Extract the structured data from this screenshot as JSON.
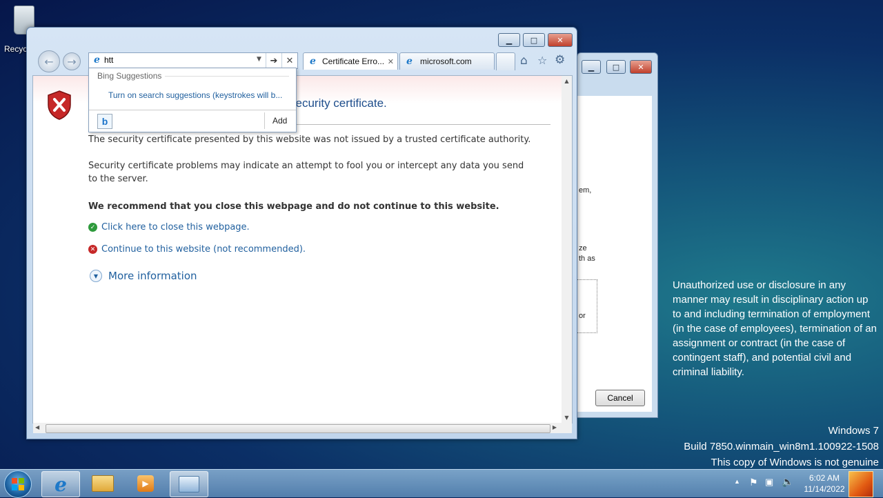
{
  "desktop": {
    "recycle_label": "Recyc",
    "notice": "Unauthorized use or disclosure in any manner may result in disciplinary action up to and including termination of employment (in the case of employees), termination of an assignment or contract (in the case of contingent staff), and potential civil and criminal liability.",
    "windows_info": {
      "line1": "Windows 7",
      "line2": "Build 7850.winmain_win8m1.100922-1508",
      "line3": "This copy of Windows is not genuine"
    }
  },
  "background_dialog": {
    "text_fragments": [
      "em,",
      "ze",
      "th as",
      "or"
    ],
    "cancel_label": "Cancel"
  },
  "browser": {
    "address_value": "htt",
    "suggestions": {
      "header": "Bing Suggestions",
      "item": "Turn on search suggestions (keystrokes will b...",
      "add_label": "Add"
    },
    "tabs": [
      {
        "label": "Certificate Erro...",
        "active": true
      },
      {
        "label": "microsoft.com",
        "active": false
      }
    ],
    "page": {
      "heading": "security certificate.",
      "para1": "The security certificate presented by this website was not issued by a trusted certificate authority.",
      "para2": "Security certificate problems may indicate an attempt to fool you or intercept any data you send to the server.",
      "recommend": "We recommend that you close this webpage and do not continue to this website.",
      "close_link": "Click here to close this webpage.",
      "continue_link": "Continue to this website (not recommended).",
      "more_info": "More information"
    }
  },
  "taskbar": {
    "time": "6:02 AM",
    "date": "11/14/2022"
  },
  "colors": {
    "link": "#1f5f9e",
    "heading": "#1f4e8c",
    "shield_red": "#c62828",
    "ok_green": "#2e9a3c"
  }
}
